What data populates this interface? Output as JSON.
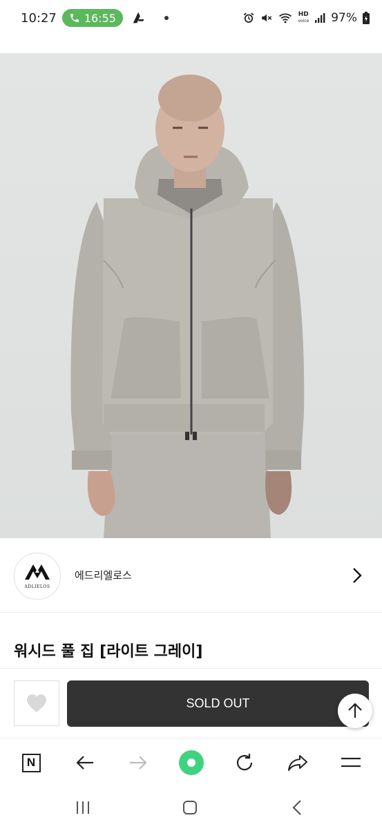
{
  "status_bar": {
    "time": "10:27",
    "call_time": "16:55",
    "battery": "97%",
    "hd_label": "HD",
    "voice_label": "voice"
  },
  "product_image": {
    "alt": "product-photo"
  },
  "brand": {
    "name": "에드리엘로스",
    "logo_text": "ADLIELOS"
  },
  "product": {
    "title": "워시드 풀 집 [라이트 그레이]"
  },
  "actions": {
    "sold_out_label": "SOLD OUT"
  },
  "browser_toolbar": {
    "home_label": "N"
  },
  "colors": {
    "sold_out_bg": "#333333",
    "call_pill": "#5cb85c",
    "green_button": "#3fd37f"
  },
  "icons": [
    "phone-icon",
    "app-icon",
    "alarm-icon",
    "mute-icon",
    "wifi-icon",
    "signal-icon",
    "battery-icon",
    "chevron-right-icon",
    "heart-icon",
    "arrow-up-icon",
    "back-arrow-icon",
    "forward-arrow-icon",
    "refresh-icon",
    "share-icon",
    "menu-icon",
    "recents-icon",
    "home-icon",
    "back-icon"
  ]
}
